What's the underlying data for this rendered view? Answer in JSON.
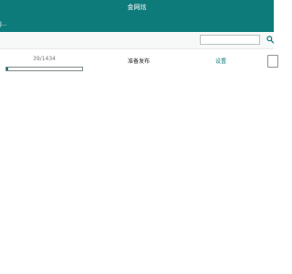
{
  "window": {
    "title": "金网炫",
    "subtitle": "J..."
  },
  "search": {
    "value": "",
    "placeholder": ""
  },
  "progress": {
    "text": "39/1434",
    "current": 39,
    "total": 1434,
    "fraction": 0.027
  },
  "status": {
    "text": "准备发布"
  },
  "actions": {
    "settings_label": "设置"
  },
  "colors": {
    "accent": "#0e7b7b",
    "background": "#ffffff"
  },
  "icons": {
    "search": "search-icon"
  }
}
